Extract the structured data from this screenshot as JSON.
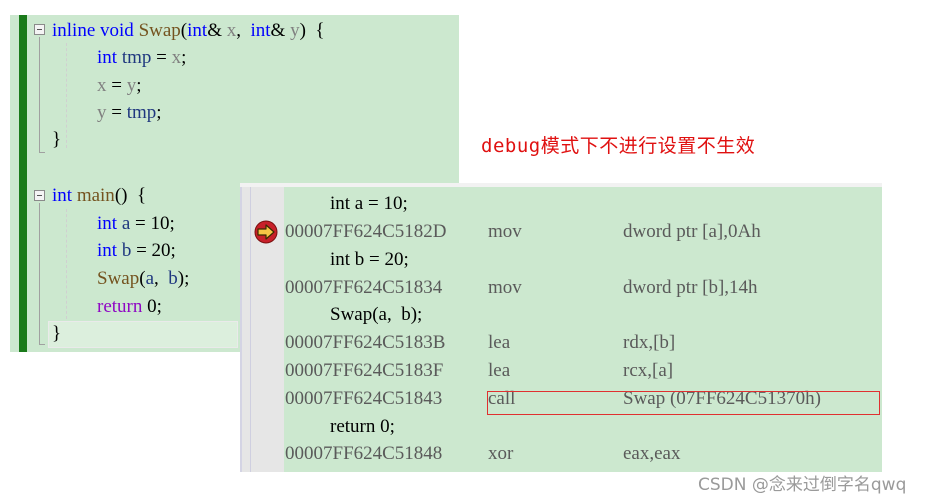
{
  "source_editor": {
    "swap_function": {
      "signature": [
        {
          "t": "inline",
          "c": "kw"
        },
        {
          "t": " ",
          "c": "pl"
        },
        {
          "t": "void",
          "c": "kw"
        },
        {
          "t": " ",
          "c": "pl"
        },
        {
          "t": "Swap",
          "c": "fn"
        },
        {
          "t": "(",
          "c": "pl"
        },
        {
          "t": "int",
          "c": "kw"
        },
        {
          "t": "& ",
          "c": "pl"
        },
        {
          "t": "x",
          "c": "pm"
        },
        {
          "t": ",  ",
          "c": "pl"
        },
        {
          "t": "int",
          "c": "kw"
        },
        {
          "t": "& ",
          "c": "pl"
        },
        {
          "t": "y",
          "c": "pm"
        },
        {
          "t": ")  {",
          "c": "pl"
        }
      ],
      "body": [
        [
          {
            "t": "int",
            "c": "kw"
          },
          {
            "t": " ",
            "c": "pl"
          },
          {
            "t": "tmp",
            "c": "lv"
          },
          {
            "t": " = ",
            "c": "pl"
          },
          {
            "t": "x",
            "c": "pm"
          },
          {
            "t": ";",
            "c": "pl"
          }
        ],
        [
          {
            "t": "x",
            "c": "pm"
          },
          {
            "t": " = ",
            "c": "pl"
          },
          {
            "t": "y",
            "c": "pm"
          },
          {
            "t": ";",
            "c": "pl"
          }
        ],
        [
          {
            "t": "y",
            "c": "pm"
          },
          {
            "t": " = ",
            "c": "pl"
          },
          {
            "t": "tmp",
            "c": "lv"
          },
          {
            "t": ";",
            "c": "pl"
          }
        ]
      ],
      "close": "}"
    },
    "main_function": {
      "signature": [
        {
          "t": "int",
          "c": "kw"
        },
        {
          "t": " ",
          "c": "pl"
        },
        {
          "t": "main",
          "c": "fn"
        },
        {
          "t": "()  {",
          "c": "pl"
        }
      ],
      "body": [
        [
          {
            "t": "int",
            "c": "kw"
          },
          {
            "t": " ",
            "c": "pl"
          },
          {
            "t": "a",
            "c": "lv"
          },
          {
            "t": " = 10;",
            "c": "pl"
          }
        ],
        [
          {
            "t": "int",
            "c": "kw"
          },
          {
            "t": " ",
            "c": "pl"
          },
          {
            "t": "b",
            "c": "lv"
          },
          {
            "t": " = 20;",
            "c": "pl"
          }
        ],
        [
          {
            "t": "Swap",
            "c": "fn"
          },
          {
            "t": "(",
            "c": "pl"
          },
          {
            "t": "a",
            "c": "lv"
          },
          {
            "t": ",  ",
            "c": "pl"
          },
          {
            "t": "b",
            "c": "lv"
          },
          {
            "t": ");",
            "c": "pl"
          }
        ],
        [
          {
            "t": "return",
            "c": "ctl"
          },
          {
            "t": " 0;",
            "c": "pl"
          }
        ]
      ],
      "close": "}"
    }
  },
  "annotation": {
    "text": "debug模式下不进行设置不生效",
    "color": "#e01010"
  },
  "disassembly": {
    "rows": [
      {
        "type": "src",
        "code": "int a = 10;"
      },
      {
        "type": "asm",
        "addr": "00007FF624C5182D",
        "mnemonic": "mov",
        "operands": "dword ptr [a],0Ah",
        "current": true
      },
      {
        "type": "src",
        "code": "int b = 20;"
      },
      {
        "type": "asm",
        "addr": "00007FF624C51834",
        "mnemonic": "mov",
        "operands": "dword ptr [b],14h"
      },
      {
        "type": "src",
        "code": "Swap(a,  b);"
      },
      {
        "type": "asm",
        "addr": "00007FF624C5183B",
        "mnemonic": "lea",
        "operands": "rdx,[b]"
      },
      {
        "type": "asm",
        "addr": "00007FF624C5183F",
        "mnemonic": "lea",
        "operands": "rcx,[a]"
      },
      {
        "type": "asm",
        "addr": "00007FF624C51843",
        "mnemonic": "call",
        "operands": "Swap (07FF624C51370h)",
        "highlighted": true
      },
      {
        "type": "src",
        "code": "return 0;"
      },
      {
        "type": "asm",
        "addr": "00007FF624C51848",
        "mnemonic": "xor",
        "operands": "eax,eax"
      }
    ],
    "highlight_color": "#e03030"
  },
  "watermark": "CSDN @念来过倒字名qwq"
}
